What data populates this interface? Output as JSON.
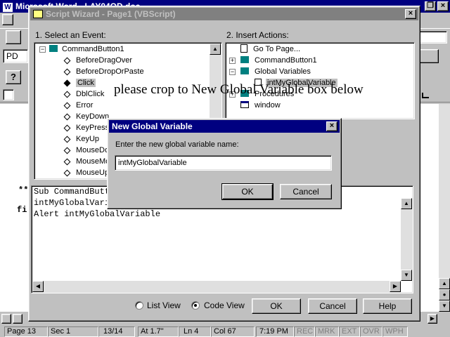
{
  "word": {
    "title": "Microsoft Word - LAY04OD.doc",
    "style_box": "PD",
    "doc_lines": [
      "**",
      "fi"
    ]
  },
  "wizard": {
    "title": "Script Wizard - Page1 (VBScript)",
    "events_label": "1. Select an Event:",
    "actions_label": "2. Insert Actions:",
    "events": {
      "root": "CommandButton1",
      "items": [
        "BeforeDragOver",
        "BeforeDropOrPaste",
        "Click",
        "DblClick",
        "Error",
        "KeyDown",
        "KeyPress",
        "KeyUp",
        "MouseDown",
        "MouseMove",
        "MouseUp"
      ]
    },
    "actions": {
      "items": [
        "Go To Page...",
        "CommandButton1",
        "Global Variables",
        "intMyGlobalVariable",
        "Procedures",
        "window"
      ]
    },
    "code_lines": [
      "Sub CommandButton1_Click()",
      "intMyGlobalVariable = \"\"",
      "Alert intMyGlobalVariable"
    ],
    "list_view": "List View",
    "code_view": "Code View",
    "ok": "OK",
    "cancel": "Cancel",
    "help": "Help"
  },
  "annotation": "please crop to New Global Variable box below",
  "dialog": {
    "title": "New Global Variable",
    "prompt": "Enter the new global variable name:",
    "value": "intMyGlobalVariable",
    "ok": "OK",
    "cancel": "Cancel",
    "close": "×"
  },
  "status": {
    "page": "Page 13",
    "sec": "Sec 1",
    "pages": "13/14",
    "at": "At 1.7\"",
    "ln": "Ln 4",
    "col": "Col 67",
    "time": "7:19 PM",
    "rec": "REC",
    "mrk": "MRK",
    "ext": "EXT",
    "ovr": "OVR",
    "wph": "WPH"
  },
  "colors": {
    "title_active": "#000080",
    "highlight": "#000080"
  }
}
